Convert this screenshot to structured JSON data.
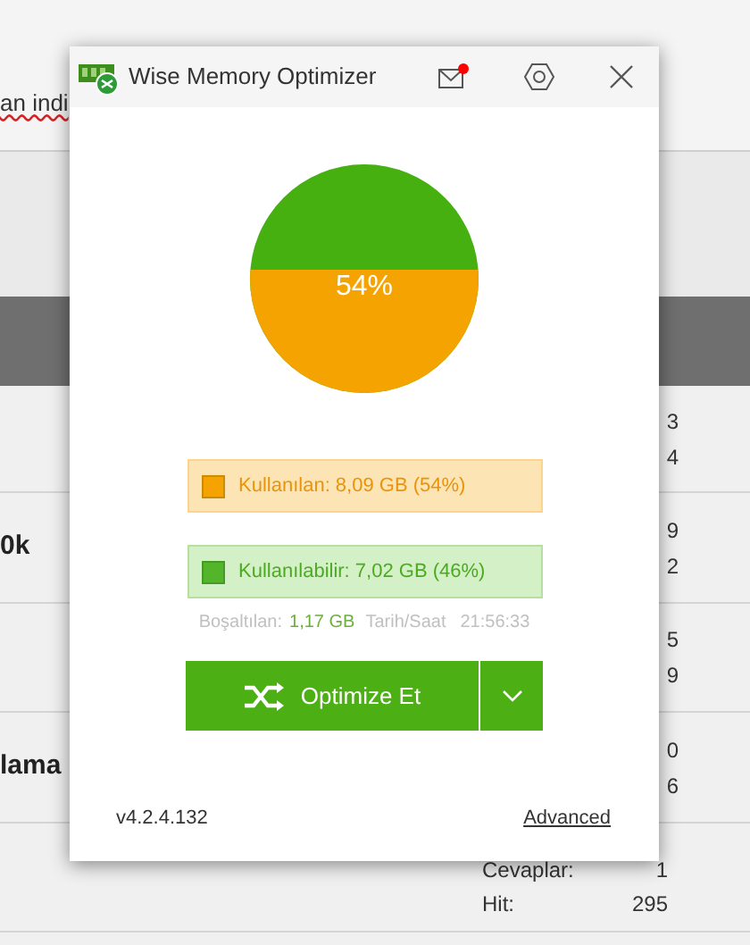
{
  "background_page": {
    "top_text": "an indi",
    "rows": [
      {
        "stats": [
          "3",
          "4"
        ]
      },
      {
        "title": "0k",
        "stats": [
          "9",
          "2"
        ]
      },
      {
        "stats": [
          "5",
          "9"
        ]
      },
      {
        "title": "lama",
        "stats": [
          "0",
          "6"
        ]
      }
    ],
    "footer_stats": [
      {
        "label": "Cevaplar:",
        "value": "1"
      },
      {
        "label": "Hit:",
        "value": "295"
      }
    ]
  },
  "window": {
    "title": "Wise Memory Optimizer",
    "mail_unread": true
  },
  "memory": {
    "percent": "54%"
  },
  "legend": [
    {
      "kind": "used",
      "label": "Kullanılan: 8,09 GB (54%)",
      "color": "#f5a300"
    },
    {
      "kind": "available",
      "label": "Kullanılabilir: 7,02 GB (46%)",
      "color": "#52b52a"
    }
  ],
  "stats": {
    "freed_label": "Boşaltılan:",
    "freed_value": "1,17 GB",
    "time_label": "Tarih/Saat",
    "time_value": "21:56:33"
  },
  "optimize_button": "Optimize Et",
  "version": "v4.2.4.132",
  "advanced_link": "Advanced"
}
